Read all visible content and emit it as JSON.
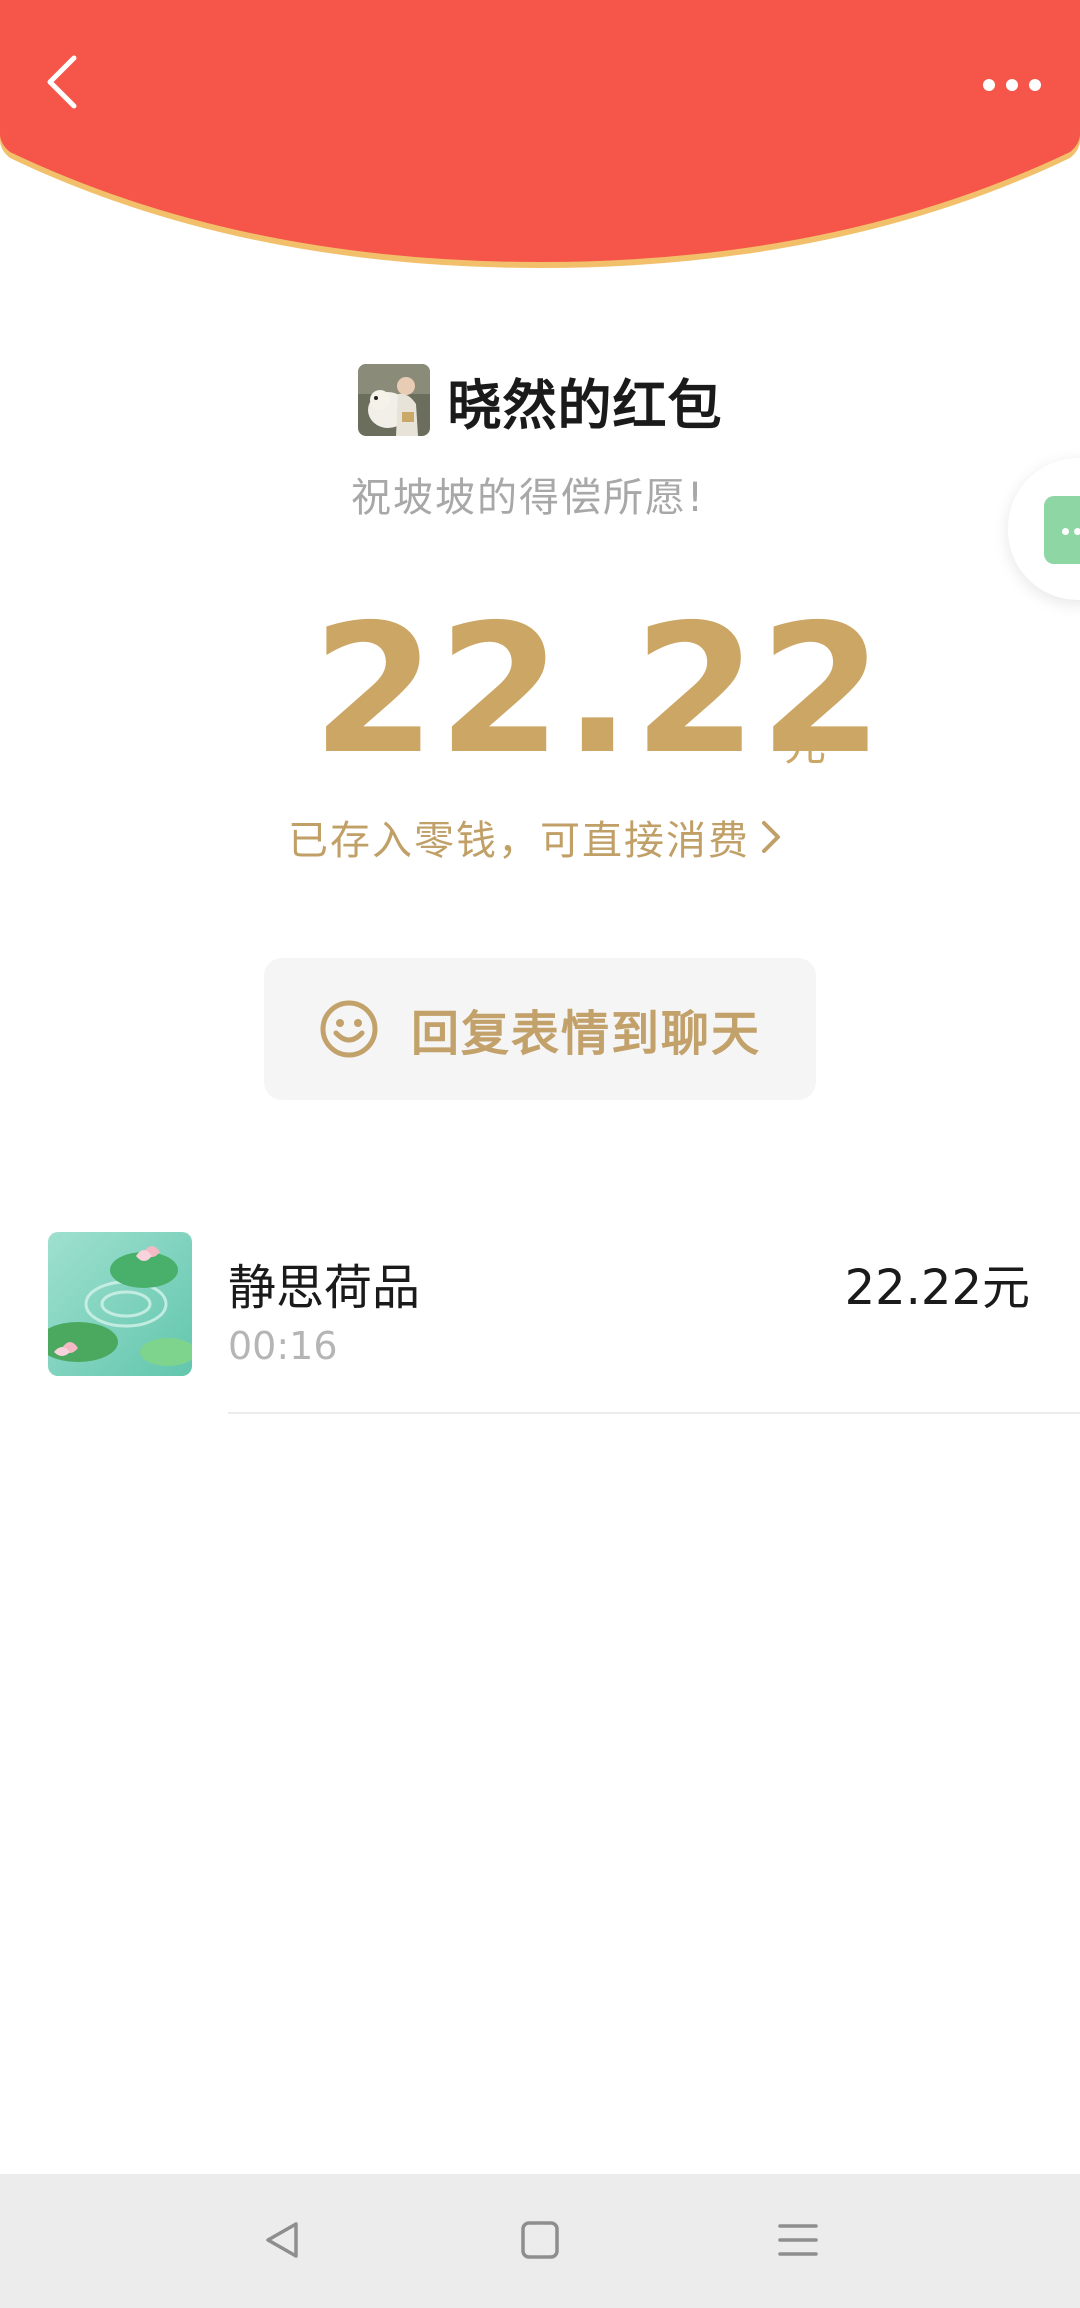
{
  "header": {
    "back_icon": "chevron-left-icon",
    "more_icon": "more-dots-icon",
    "color": "#f55649",
    "edge_color": "#f2c06b"
  },
  "sender": {
    "title": "晓然的红包",
    "blessing": "祝坡坡的得偿所愿!"
  },
  "amount": {
    "value": "22.22",
    "unit": "元",
    "color": "#cca665"
  },
  "wallet_link": {
    "text": "已存入零钱，可直接消费"
  },
  "reply_button": {
    "label": "回复表情到聊天",
    "icon": "smiley-icon"
  },
  "receivers": [
    {
      "name": "静思荷品",
      "time": "00:16",
      "amount": "22.22元"
    }
  ],
  "system_nav": {
    "back_icon": "triangle-back-icon",
    "home_icon": "square-home-icon",
    "menu_icon": "menu-lines-icon"
  }
}
